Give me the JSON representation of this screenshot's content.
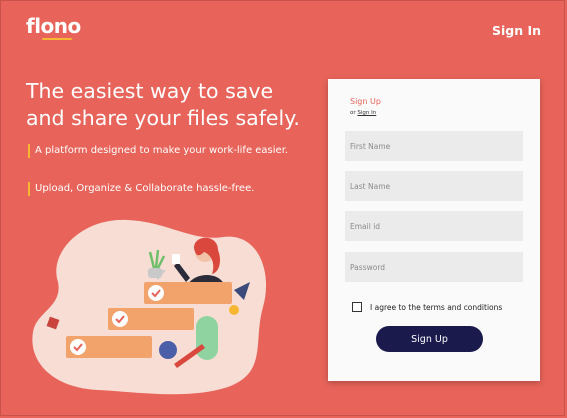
{
  "header": {
    "logo_text": "flono",
    "signin_label": "Sign In"
  },
  "hero": {
    "headline": "The easiest way to save and share your files safely.",
    "taglines": [
      "A platform designed to make your work-life easier.",
      "Upload, Organize & Collaborate hassle-free."
    ]
  },
  "form": {
    "title": "Sign Up",
    "or_text": "or",
    "signin_link": "Sign In",
    "fields": [
      {
        "placeholder": "First Name",
        "value": ""
      },
      {
        "placeholder": "Last Name",
        "value": ""
      },
      {
        "placeholder": "Email id",
        "value": ""
      },
      {
        "placeholder": "Password",
        "value": ""
      }
    ],
    "terms_label": "I agree to the terms and conditions",
    "terms_checked": false,
    "submit_label": "Sign Up"
  },
  "colors": {
    "background": "#e8645a",
    "accent": "#f7b733",
    "button": "#1b1a4d",
    "card": "#fafafa",
    "field": "#ebebeb"
  },
  "icons": [
    "checkmark-icon",
    "illustration-person",
    "plant-icon"
  ]
}
